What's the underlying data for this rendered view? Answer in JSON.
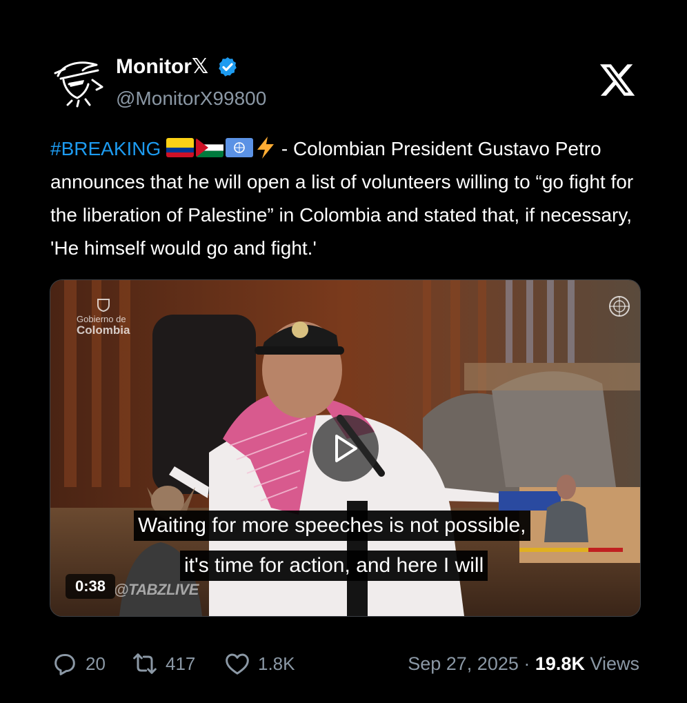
{
  "author": {
    "display_name": "Monitor",
    "display_name_suffix": "𝕏",
    "handle": "@MonitorX99800",
    "verified": true,
    "avatar_icon": "ninja-warrior-avatar"
  },
  "platform_logo": "x-logo-icon",
  "tweet": {
    "hashtag": "#BREAKING",
    "emojis": [
      "colombia-flag",
      "palestine-flag",
      "united-nations-flag",
      "lightning-bolt"
    ],
    "text_part_1": " - Colombian President Gustavo Petro announces that he will open a list of volunteers willing to “go fight for the liberation of Palestine” in Colombia and stated that, if necessary, 'He himself would go and fight.'"
  },
  "video": {
    "overlay_logo_line1": "Gobierno de",
    "overlay_logo_line2": "Colombia",
    "caption_line_1": "Waiting for more speeches is not possible,",
    "caption_line_2": "it's time for action, and here I will",
    "duration": "0:38",
    "watermark": "@TABZLIVE"
  },
  "stats": {
    "replies": "20",
    "reposts": "417",
    "likes": "1.8K"
  },
  "meta": {
    "date": "Sep 27, 2025",
    "separator": " · ",
    "views_count": "19.8K",
    "views_label": " Views"
  },
  "colors": {
    "background": "#000000",
    "hashtag": "#1d9bf0",
    "verified_badge": "#1d9bf0",
    "secondary_text": "#8b98a5"
  }
}
